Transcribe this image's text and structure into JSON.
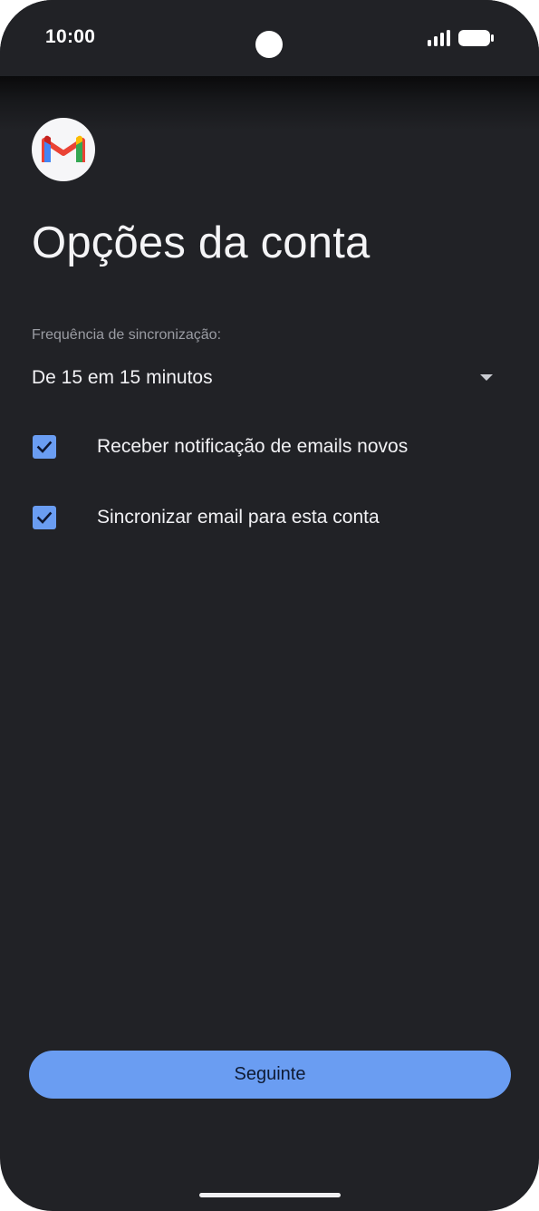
{
  "status_bar": {
    "time": "10:00",
    "icons": [
      "signal-icon",
      "battery-icon"
    ]
  },
  "app": {
    "icon": "gmail-logo-icon"
  },
  "page": {
    "title": "Opções da conta"
  },
  "sync": {
    "label": "Frequência de sincronização:",
    "selected_value": "De 15 em 15 minutos"
  },
  "options": [
    {
      "label": "Receber notificação de emails novos",
      "checked": true
    },
    {
      "label": "Sincronizar email para esta conta",
      "checked": true
    }
  ],
  "footer": {
    "next_label": "Seguinte"
  },
  "colors": {
    "background": "#212226",
    "accent": "#6a9df2",
    "text": "#f1f1f4",
    "muted_text": "#9a9ca3"
  }
}
